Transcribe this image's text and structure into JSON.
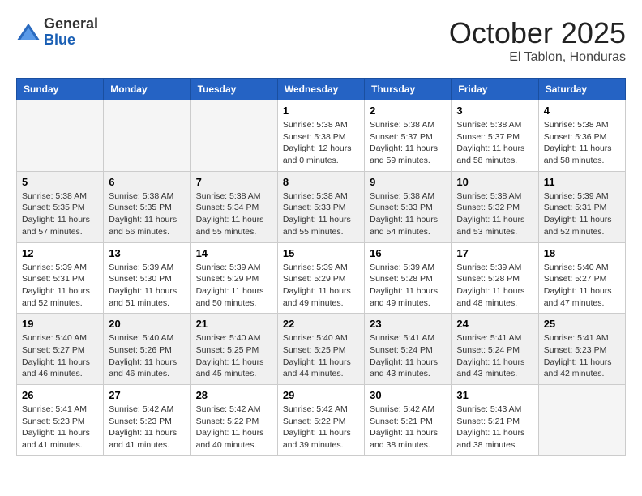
{
  "logo": {
    "line1": "General",
    "line2": "Blue"
  },
  "title": "October 2025",
  "subtitle": "El Tablon, Honduras",
  "days_header": [
    "Sunday",
    "Monday",
    "Tuesday",
    "Wednesday",
    "Thursday",
    "Friday",
    "Saturday"
  ],
  "weeks": [
    [
      {
        "day": "",
        "info": ""
      },
      {
        "day": "",
        "info": ""
      },
      {
        "day": "",
        "info": ""
      },
      {
        "day": "1",
        "info": "Sunrise: 5:38 AM\nSunset: 5:38 PM\nDaylight: 12 hours\nand 0 minutes."
      },
      {
        "day": "2",
        "info": "Sunrise: 5:38 AM\nSunset: 5:37 PM\nDaylight: 11 hours\nand 59 minutes."
      },
      {
        "day": "3",
        "info": "Sunrise: 5:38 AM\nSunset: 5:37 PM\nDaylight: 11 hours\nand 58 minutes."
      },
      {
        "day": "4",
        "info": "Sunrise: 5:38 AM\nSunset: 5:36 PM\nDaylight: 11 hours\nand 58 minutes."
      }
    ],
    [
      {
        "day": "5",
        "info": "Sunrise: 5:38 AM\nSunset: 5:35 PM\nDaylight: 11 hours\nand 57 minutes."
      },
      {
        "day": "6",
        "info": "Sunrise: 5:38 AM\nSunset: 5:35 PM\nDaylight: 11 hours\nand 56 minutes."
      },
      {
        "day": "7",
        "info": "Sunrise: 5:38 AM\nSunset: 5:34 PM\nDaylight: 11 hours\nand 55 minutes."
      },
      {
        "day": "8",
        "info": "Sunrise: 5:38 AM\nSunset: 5:33 PM\nDaylight: 11 hours\nand 55 minutes."
      },
      {
        "day": "9",
        "info": "Sunrise: 5:38 AM\nSunset: 5:33 PM\nDaylight: 11 hours\nand 54 minutes."
      },
      {
        "day": "10",
        "info": "Sunrise: 5:38 AM\nSunset: 5:32 PM\nDaylight: 11 hours\nand 53 minutes."
      },
      {
        "day": "11",
        "info": "Sunrise: 5:39 AM\nSunset: 5:31 PM\nDaylight: 11 hours\nand 52 minutes."
      }
    ],
    [
      {
        "day": "12",
        "info": "Sunrise: 5:39 AM\nSunset: 5:31 PM\nDaylight: 11 hours\nand 52 minutes."
      },
      {
        "day": "13",
        "info": "Sunrise: 5:39 AM\nSunset: 5:30 PM\nDaylight: 11 hours\nand 51 minutes."
      },
      {
        "day": "14",
        "info": "Sunrise: 5:39 AM\nSunset: 5:29 PM\nDaylight: 11 hours\nand 50 minutes."
      },
      {
        "day": "15",
        "info": "Sunrise: 5:39 AM\nSunset: 5:29 PM\nDaylight: 11 hours\nand 49 minutes."
      },
      {
        "day": "16",
        "info": "Sunrise: 5:39 AM\nSunset: 5:28 PM\nDaylight: 11 hours\nand 49 minutes."
      },
      {
        "day": "17",
        "info": "Sunrise: 5:39 AM\nSunset: 5:28 PM\nDaylight: 11 hours\nand 48 minutes."
      },
      {
        "day": "18",
        "info": "Sunrise: 5:40 AM\nSunset: 5:27 PM\nDaylight: 11 hours\nand 47 minutes."
      }
    ],
    [
      {
        "day": "19",
        "info": "Sunrise: 5:40 AM\nSunset: 5:27 PM\nDaylight: 11 hours\nand 46 minutes."
      },
      {
        "day": "20",
        "info": "Sunrise: 5:40 AM\nSunset: 5:26 PM\nDaylight: 11 hours\nand 46 minutes."
      },
      {
        "day": "21",
        "info": "Sunrise: 5:40 AM\nSunset: 5:25 PM\nDaylight: 11 hours\nand 45 minutes."
      },
      {
        "day": "22",
        "info": "Sunrise: 5:40 AM\nSunset: 5:25 PM\nDaylight: 11 hours\nand 44 minutes."
      },
      {
        "day": "23",
        "info": "Sunrise: 5:41 AM\nSunset: 5:24 PM\nDaylight: 11 hours\nand 43 minutes."
      },
      {
        "day": "24",
        "info": "Sunrise: 5:41 AM\nSunset: 5:24 PM\nDaylight: 11 hours\nand 43 minutes."
      },
      {
        "day": "25",
        "info": "Sunrise: 5:41 AM\nSunset: 5:23 PM\nDaylight: 11 hours\nand 42 minutes."
      }
    ],
    [
      {
        "day": "26",
        "info": "Sunrise: 5:41 AM\nSunset: 5:23 PM\nDaylight: 11 hours\nand 41 minutes."
      },
      {
        "day": "27",
        "info": "Sunrise: 5:42 AM\nSunset: 5:23 PM\nDaylight: 11 hours\nand 41 minutes."
      },
      {
        "day": "28",
        "info": "Sunrise: 5:42 AM\nSunset: 5:22 PM\nDaylight: 11 hours\nand 40 minutes."
      },
      {
        "day": "29",
        "info": "Sunrise: 5:42 AM\nSunset: 5:22 PM\nDaylight: 11 hours\nand 39 minutes."
      },
      {
        "day": "30",
        "info": "Sunrise: 5:42 AM\nSunset: 5:21 PM\nDaylight: 11 hours\nand 38 minutes."
      },
      {
        "day": "31",
        "info": "Sunrise: 5:43 AM\nSunset: 5:21 PM\nDaylight: 11 hours\nand 38 minutes."
      },
      {
        "day": "",
        "info": ""
      }
    ]
  ]
}
